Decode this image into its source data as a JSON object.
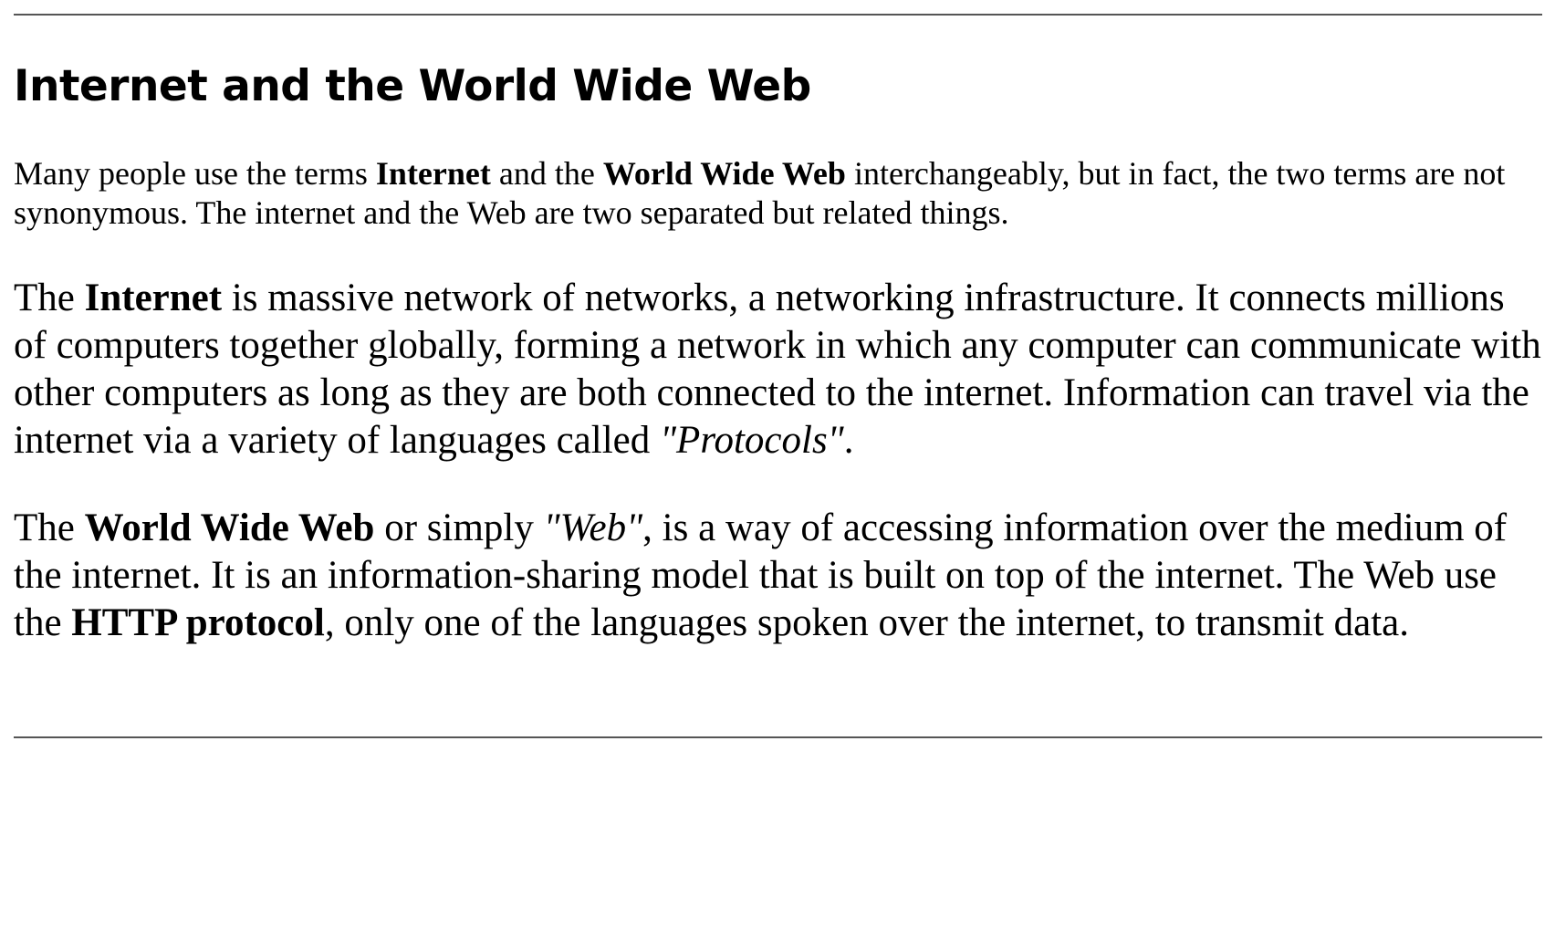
{
  "title": "Internet and the World Wide Web",
  "intro": {
    "t1": "Many people use the terms ",
    "b1": "Internet",
    "t2": " and the ",
    "b2": "World Wide Web",
    "t3": " interchangeably, but in fact, the two terms are not synonymous. The internet and the Web are two separated but related things."
  },
  "internet_paragraph": {
    "t1": "The ",
    "b1": "Internet",
    "t2": " is massive network of networks, a networking infrastructure. It connects millions of computers together globally, forming a network in which any computer can communicate with other computers as long as they are both connected to the internet. Information can travel via the internet via a variety of languages called ",
    "i1": "\"Protocols\"",
    "t3": "."
  },
  "web_paragraph": {
    "t1": "The ",
    "b1": "World Wide Web",
    "t2": " or simply ",
    "i1": "\"Web\"",
    "t3": ", is a way of accessing information over the medium of the internet. It is an information-sharing model that is built on top of the internet. The Web use the ",
    "b2": "HTTP protocol",
    "t4": ", only one of the languages spoken over the internet, to transmit data."
  }
}
